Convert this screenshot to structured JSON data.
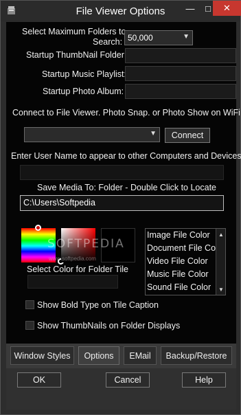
{
  "window": {
    "title": "File Viewer Options",
    "minimize_glyph": "—",
    "maximize_glyph": "□",
    "close_glyph": "✕"
  },
  "form": {
    "max_folders_label_line1": "Select Maximum Folders to",
    "max_folders_label_line2": "Search:",
    "max_folders_value": "50,000",
    "thumbnail_folder_label": "Startup ThumbNail Folder:",
    "music_playlist_label": "Startup Music Playlist:",
    "photo_album_label": "Startup Photo Album:",
    "wifi_label": "Connect to File Viewer. Photo Snap. or Photo Show on WiFi",
    "connect_label": "Connect",
    "username_label": "Enter User Name to appear to other Computers and Devices",
    "save_media_label": "Save Media To: Folder - Double Click to Locate",
    "save_media_path": "C:\\Users\\Softpedia"
  },
  "colors": {
    "watermark": "SOFTPEDIA",
    "watermark_url": "www.softpedia.com",
    "select_color_label": "Select Color for Folder Tile",
    "file_color_items": [
      "Image File Color",
      "Document File Color",
      "Video File Color",
      "Music File Color",
      "Sound File Color"
    ]
  },
  "options": {
    "bold_caption_label": "Show Bold Type on Tile Caption",
    "thumbnails_label": "Show ThumbNails on Folder Displays"
  },
  "tabs": [
    {
      "label": "Window Styles"
    },
    {
      "label": "Options"
    },
    {
      "label": "EMail"
    },
    {
      "label": "Backup/Restore"
    }
  ],
  "buttons": {
    "ok": "OK",
    "cancel": "Cancel",
    "help": "Help"
  }
}
